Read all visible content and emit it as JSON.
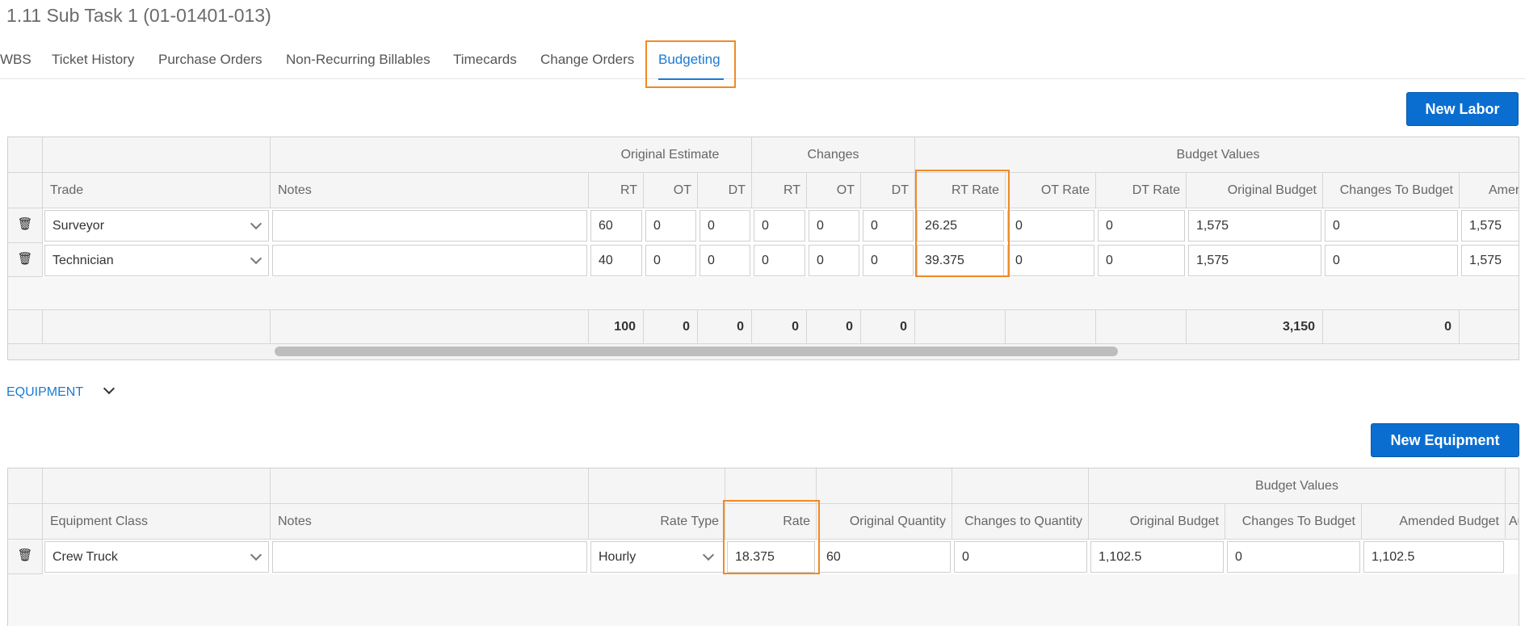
{
  "page": {
    "title": "1.11 Sub Task 1 (01-01401-013)"
  },
  "tabs": [
    "WBS",
    "Ticket History",
    "Purchase Orders",
    "Non-Recurring Billables",
    "Timecards",
    "Change Orders",
    "Budgeting"
  ],
  "active_tab": "Budgeting",
  "labor": {
    "new_button": "New Labor",
    "group_headers": {
      "original_estimate": "Original Estimate",
      "changes": "Changes",
      "budget_values": "Budget Values"
    },
    "columns": {
      "trade": "Trade",
      "notes": "Notes",
      "oe_rt": "RT",
      "oe_ot": "OT",
      "oe_dt": "DT",
      "ch_rt": "RT",
      "ch_ot": "OT",
      "ch_dt": "DT",
      "rt_rate": "RT Rate",
      "ot_rate": "OT Rate",
      "dt_rate": "DT Rate",
      "original_budget": "Original Budget",
      "changes_to_budget": "Changes To Budget",
      "amended": "Amer"
    },
    "rows": [
      {
        "trade": "Surveyor",
        "notes": "",
        "oe_rt": "60",
        "oe_ot": "0",
        "oe_dt": "0",
        "ch_rt": "0",
        "ch_ot": "0",
        "ch_dt": "0",
        "rt_rate": "26.25",
        "ot_rate": "0",
        "dt_rate": "0",
        "original_budget": "1,575",
        "changes_to_budget": "0",
        "amended": "1,575"
      },
      {
        "trade": "Technician",
        "notes": "",
        "oe_rt": "40",
        "oe_ot": "0",
        "oe_dt": "0",
        "ch_rt": "0",
        "ch_ot": "0",
        "ch_dt": "0",
        "rt_rate": "39.375",
        "ot_rate": "0",
        "dt_rate": "0",
        "original_budget": "1,575",
        "changes_to_budget": "0",
        "amended": "1,575"
      }
    ],
    "totals": {
      "oe_rt": "100",
      "oe_ot": "0",
      "oe_dt": "0",
      "ch_rt": "0",
      "ch_ot": "0",
      "ch_dt": "0",
      "original_budget": "3,150",
      "changes_to_budget": "0"
    }
  },
  "equipment": {
    "section_label": "EQUIPMENT",
    "new_button": "New Equipment",
    "group_headers": {
      "budget_values": "Budget Values"
    },
    "columns": {
      "equipment_class": "Equipment Class",
      "notes": "Notes",
      "rate_type": "Rate Type",
      "rate": "Rate",
      "original_quantity": "Original Quantity",
      "changes_to_quantity": "Changes to Quantity",
      "original_budget": "Original Budget",
      "changes_to_budget": "Changes To Budget",
      "amended_budget": "Amended Budget",
      "au": "Au"
    },
    "rows": [
      {
        "equipment_class": "Crew Truck",
        "notes": "",
        "rate_type": "Hourly",
        "rate": "18.375",
        "original_quantity": "60",
        "changes_to_quantity": "0",
        "original_budget": "1,102.5",
        "changes_to_budget": "0",
        "amended_budget": "1,102.5"
      }
    ]
  },
  "colors": {
    "accent": "#1a7bd4",
    "button": "#0a6ed1",
    "highlight": "#f08a24"
  }
}
